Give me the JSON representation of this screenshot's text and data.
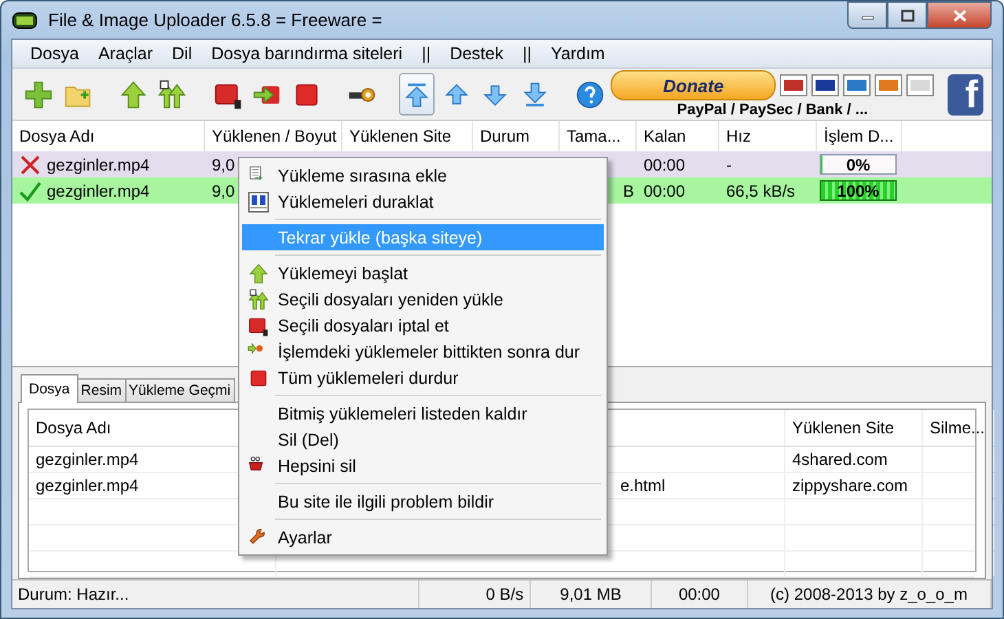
{
  "window": {
    "title": "File & Image Uploader 6.5.8  = Freeware ="
  },
  "menu": [
    "Dosya",
    "Araçlar",
    "Dil",
    "Dosya barındırma siteleri",
    "||",
    "Destek",
    "||",
    "Yardım"
  ],
  "toolbar": {
    "buttons": [
      {
        "kind": "add",
        "pressed": false
      },
      {
        "kind": "folder",
        "pressed": false
      },
      {
        "kind": "upload",
        "pressed": false
      },
      {
        "kind": "reupload",
        "pressed": false
      },
      {
        "kind": "cancel",
        "pressed": false
      },
      {
        "kind": "pause",
        "pressed": false
      },
      {
        "kind": "stop",
        "pressed": false
      },
      {
        "kind": "key",
        "pressed": false
      },
      {
        "kind": "top",
        "pressed": true
      },
      {
        "kind": "up",
        "pressed": false
      },
      {
        "kind": "down",
        "pressed": false
      },
      {
        "kind": "bottom",
        "pressed": false
      },
      {
        "kind": "help",
        "pressed": false
      }
    ],
    "donate": "Donate",
    "donate_caption": "PayPal / PaySec / Bank / ...",
    "facebook": "f"
  },
  "uploads": {
    "columns": [
      "Dosya Adı",
      "Yüklenen / Boyut",
      "Yüklenen Site",
      "Durum",
      "Tama...",
      "Kalan",
      "Hız",
      "İşlem D..."
    ],
    "rows": [
      {
        "failed": true,
        "file": "gezginler.mp4",
        "uploaded_size": "9,0",
        "remaining": "00:00",
        "speed": "-",
        "progress": {
          "level": 0,
          "reading": "0%"
        }
      },
      {
        "failed": false,
        "file": "gezginler.mp4",
        "uploaded_size": "9,0",
        "completed": "B",
        "remaining": "00:00",
        "speed": "66,5 kB/s",
        "progress": {
          "level": 1,
          "reading": "100%"
        }
      }
    ]
  },
  "tabs": [
    {
      "label": "Dosya",
      "selected": true
    },
    {
      "label": "Resim",
      "selected": false
    },
    {
      "label": "Yükleme Geçmi",
      "selected": false
    }
  ],
  "history": {
    "columns": [
      "Dosya Adı",
      "Yüklenen Site",
      "Silme..."
    ],
    "rows": [
      {
        "file": "gezginler.mp4",
        "site": "4shared.com"
      },
      {
        "file": "gezginler.mp4",
        "link": "e.html",
        "site": "zippyshare.com"
      }
    ]
  },
  "status_bar": [
    "Durum: Hazır...",
    "0 B/s",
    "9,01 MB",
    "00:00",
    "(c) 2008-2013 by z_o_o_m"
  ],
  "context_menu": {
    "groups": [
      [
        {
          "label": "Yükleme sırasına ekle",
          "selected": false
        },
        {
          "label": "Yüklemeleri duraklat",
          "selected": false
        }
      ],
      [
        {
          "label": "Tekrar yükle (başka siteye)",
          "selected": true
        }
      ],
      [
        {
          "label": "Yüklemeyi başlat",
          "selected": false
        },
        {
          "label": "Seçili dosyaları yeniden yükle",
          "selected": false
        },
        {
          "label": "Seçili dosyaları iptal et",
          "selected": false
        },
        {
          "label": "İşlemdeki yüklemeler bittikten sonra dur",
          "selected": false
        },
        {
          "label": "Tüm yüklemeleri durdur",
          "selected": false
        }
      ],
      [
        {
          "label": "Bitmiş yüklemeleri listeden kaldır",
          "selected": false
        },
        {
          "label": "Sil (Del)",
          "selected": false
        },
        {
          "label": "Hepsini sil",
          "selected": false
        }
      ],
      [
        {
          "label": "Bu site ile ilgili problem bildir",
          "selected": false
        }
      ],
      [
        {
          "label": "Ayarlar",
          "selected": false
        }
      ]
    ]
  }
}
